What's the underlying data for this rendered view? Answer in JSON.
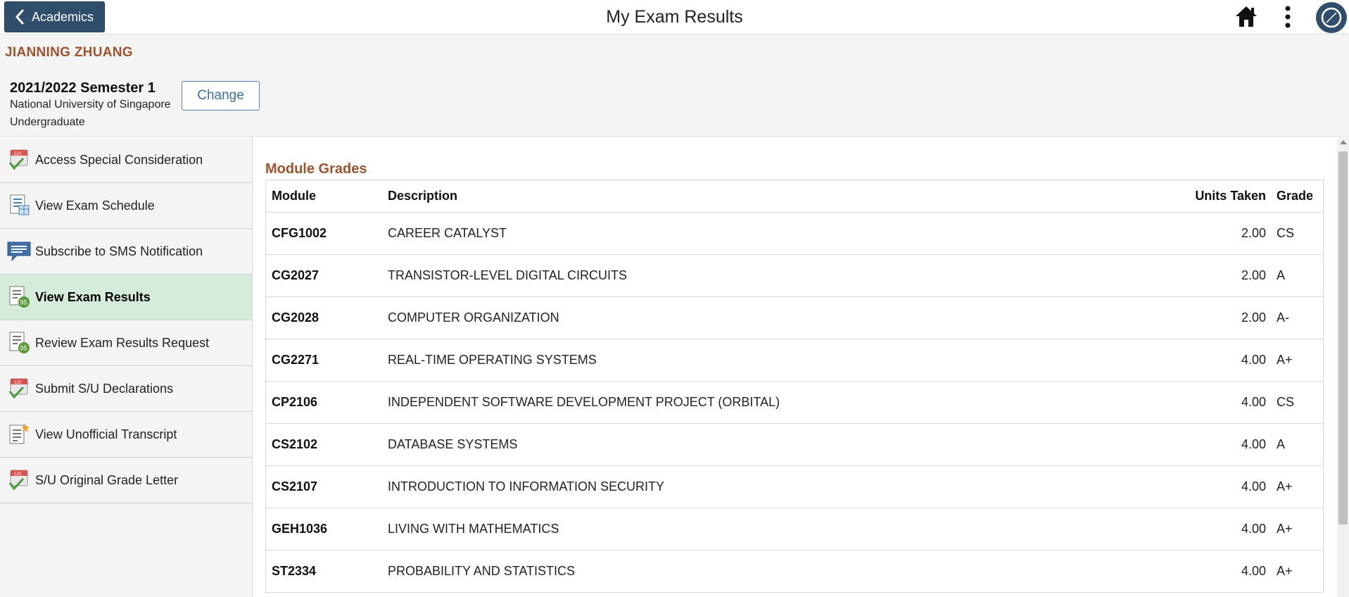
{
  "header": {
    "back_label": "Academics",
    "title": "My Exam Results",
    "icons": [
      "home-icon",
      "more-vertical-icon",
      "navbar-compass-icon"
    ]
  },
  "student": {
    "name": "JIANNING ZHUANG",
    "term": "2021/2022 Semester 1",
    "institution": "National University of Singapore",
    "career": "Undergraduate",
    "change_label": "Change"
  },
  "sidebar": {
    "items": [
      {
        "label": "Access Special Consideration",
        "icon": "calendar-check-icon",
        "active": false
      },
      {
        "label": "View Exam Schedule",
        "icon": "schedule-list-icon",
        "active": false
      },
      {
        "label": "Subscribe to SMS Notification",
        "icon": "message-bubble-icon",
        "active": false
      },
      {
        "label": "View Exam Results",
        "icon": "results-badge-icon",
        "active": true
      },
      {
        "label": "Review Exam Results Request",
        "icon": "results-badge-icon",
        "active": false
      },
      {
        "label": "Submit S/U Declarations",
        "icon": "calendar-check-icon",
        "active": false
      },
      {
        "label": "View Unofficial Transcript",
        "icon": "transcript-star-icon",
        "active": false
      },
      {
        "label": "S/U Original Grade Letter",
        "icon": "calendar-check-icon",
        "active": false
      }
    ]
  },
  "main": {
    "section_title": "Module Grades",
    "columns": {
      "module": "Module",
      "description": "Description",
      "units": "Units Taken",
      "grade": "Grade"
    },
    "rows": [
      {
        "module": "CFG1002",
        "description": "CAREER CATALYST",
        "units": "2.00",
        "grade": "CS"
      },
      {
        "module": "CG2027",
        "description": "TRANSISTOR-LEVEL DIGITAL CIRCUITS",
        "units": "2.00",
        "grade": "A"
      },
      {
        "module": "CG2028",
        "description": "COMPUTER ORGANIZATION",
        "units": "2.00",
        "grade": "A-"
      },
      {
        "module": "CG2271",
        "description": "REAL-TIME OPERATING SYSTEMS",
        "units": "4.00",
        "grade": "A+"
      },
      {
        "module": "CP2106",
        "description": "INDEPENDENT SOFTWARE DEVELOPMENT PROJECT (ORBITAL)",
        "units": "4.00",
        "grade": "CS"
      },
      {
        "module": "CS2102",
        "description": "DATABASE SYSTEMS",
        "units": "4.00",
        "grade": "A"
      },
      {
        "module": "CS2107",
        "description": "INTRODUCTION TO INFORMATION SECURITY",
        "units": "4.00",
        "grade": "A+"
      },
      {
        "module": "GEH1036",
        "description": "LIVING WITH MATHEMATICS",
        "units": "4.00",
        "grade": "A+"
      },
      {
        "module": "ST2334",
        "description": "PROBABILITY AND STATISTICS",
        "units": "4.00",
        "grade": "A+"
      }
    ]
  },
  "colors": {
    "accent_brown": "#a0522d",
    "back_button": "#2e4e6b",
    "active_item": "#d4ecd9",
    "link_blue": "#3a6ea5"
  }
}
